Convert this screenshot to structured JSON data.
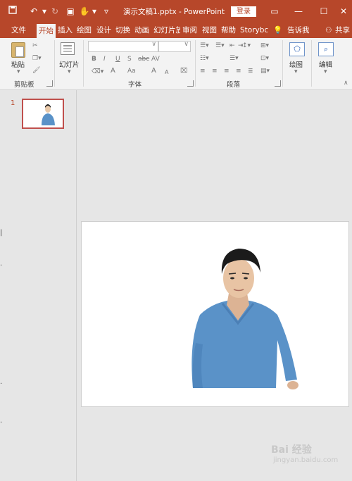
{
  "window": {
    "title": "演示文稿1.pptx  -  PowerPoint",
    "login_label": "登录"
  },
  "tabs": [
    "文件",
    "开始",
    "插入",
    "绘图",
    "设计",
    "切换",
    "动画",
    "幻灯片放",
    "审阅",
    "视图",
    "帮助",
    "Storybc",
    "告诉我",
    "共享"
  ],
  "ribbon": {
    "clipboard": {
      "paste_label": "粘贴",
      "group_label": "剪贴板"
    },
    "slides": {
      "new_slide_label": "幻灯片"
    },
    "font": {
      "group_label": "字体",
      "bold": "B",
      "italic": "I",
      "underline": "U",
      "strike": "S",
      "abc": "abc",
      "spacing": "AV",
      "font_color": "A",
      "case": "Aa",
      "grow": "A",
      "shrink": "A"
    },
    "paragraph": {
      "group_label": "段落"
    },
    "drawing": {
      "label": "绘图"
    },
    "editing": {
      "label": "编辑"
    }
  },
  "thumbnails": [
    {
      "number": "1"
    }
  ],
  "watermark": {
    "text": "Bai 经验",
    "sub": "jingyan.baidu.com"
  },
  "colors": {
    "accent": "#b7472a",
    "ribbon_bg": "#f3f3f3",
    "canvas_bg": "#e6e6e6",
    "sweater": "#5a92c8"
  }
}
